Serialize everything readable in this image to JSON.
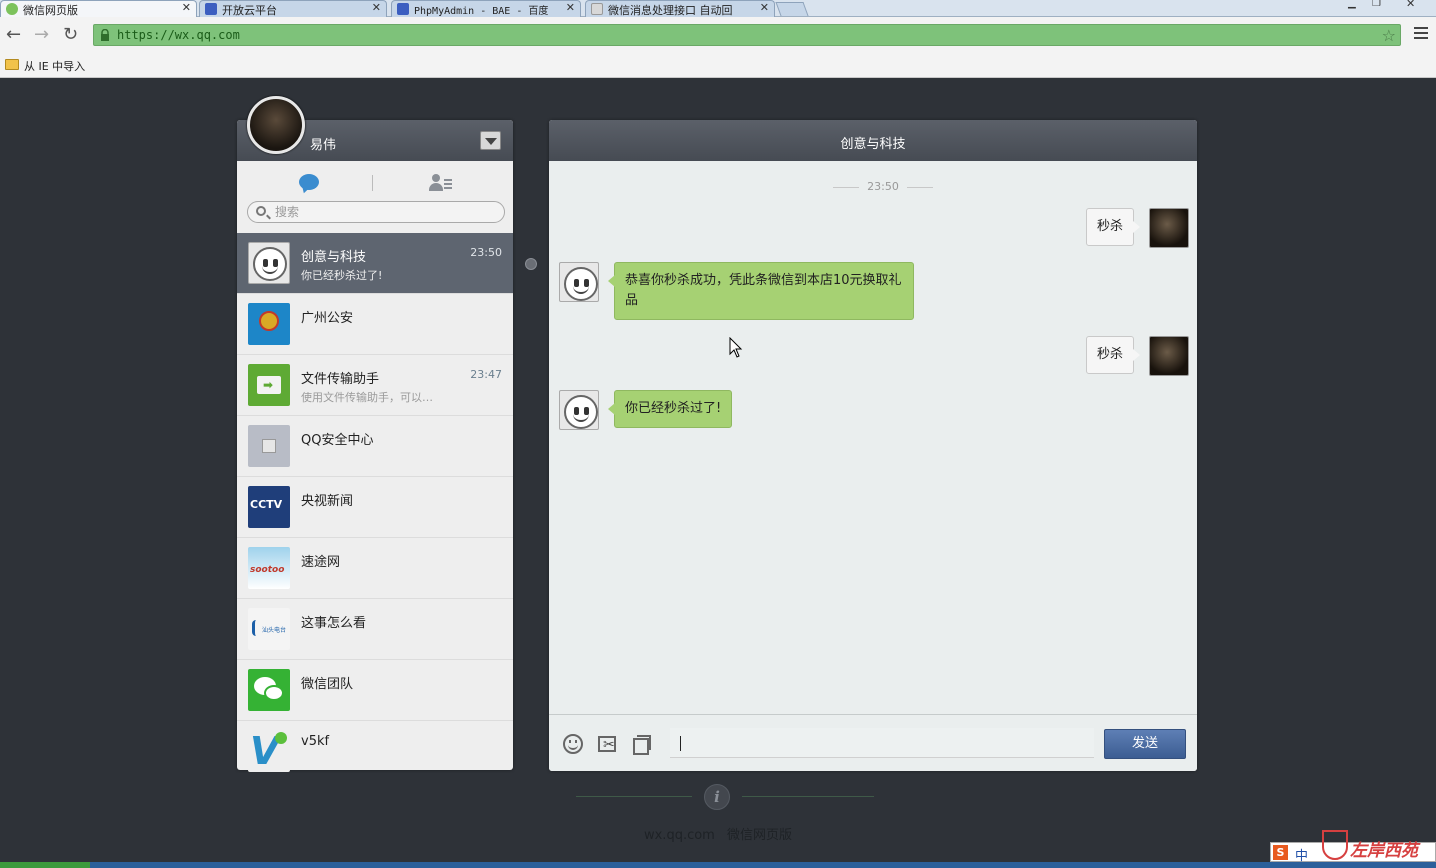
{
  "browser": {
    "tabs": [
      {
        "title": "微信网页版",
        "active": true
      },
      {
        "title": "开放云平台",
        "active": false
      },
      {
        "title": "PhpMyAdmin - BAE - 百度",
        "active": false
      },
      {
        "title": "微信消息处理接口 自动回",
        "active": false
      }
    ],
    "url": "https://wx.qq.com",
    "bookmark": "从 IE 中导入",
    "icons": {
      "back": "back-arrow-icon",
      "forward": "forward-arrow-icon",
      "reload": "reload-icon",
      "star": "star-icon",
      "menu": "menu-icon",
      "lock": "lock-icon"
    }
  },
  "sidebar": {
    "user_name": "易伟",
    "search_placeholder": "搜索",
    "conversations": [
      {
        "name": "创意与科技",
        "time": "23:50",
        "preview": "你已经秒杀过了!",
        "active": true,
        "avatar": "smiley"
      },
      {
        "name": "广州公安",
        "time": "",
        "preview": "",
        "active": false,
        "avatar": "police"
      },
      {
        "name": "文件传输助手",
        "time": "23:47",
        "preview": "使用文件传输助手，可以…",
        "active": false,
        "avatar": "file"
      },
      {
        "name": "QQ安全中心",
        "time": "",
        "preview": "",
        "active": false,
        "avatar": "qq"
      },
      {
        "name": "央视新闻",
        "time": "",
        "preview": "",
        "active": false,
        "avatar": "cctv"
      },
      {
        "name": "速途网",
        "time": "",
        "preview": "",
        "active": false,
        "avatar": "sootoo"
      },
      {
        "name": "这事怎么看",
        "time": "",
        "preview": "",
        "active": false,
        "avatar": "shantou"
      },
      {
        "name": "微信团队",
        "time": "",
        "preview": "",
        "active": false,
        "avatar": "wechat"
      },
      {
        "name": "v5kf",
        "time": "",
        "preview": "",
        "active": false,
        "avatar": "v5"
      }
    ]
  },
  "chat": {
    "title": "创意与科技",
    "timestamp": "23:50",
    "messages": [
      {
        "dir": "out",
        "text": "秒杀"
      },
      {
        "dir": "in",
        "text": "恭喜你秒杀成功，凭此条微信到本店10元换取礼品"
      },
      {
        "dir": "out",
        "text": "秒杀"
      },
      {
        "dir": "in",
        "text": "你已经秒杀过了!"
      }
    ],
    "input_value": "",
    "send_label": "发送"
  },
  "footer": {
    "domain": "wx.qq.com",
    "product": "微信网页版"
  },
  "taskbar": {
    "ime_s": "S",
    "ime_lang": "中",
    "watermark": "左岸西苑"
  },
  "colors": {
    "page_bg": "#2e3238",
    "panel_header": "#4f545c",
    "bubble_in": "#a6d173",
    "send_button": "#4a6aa0"
  }
}
